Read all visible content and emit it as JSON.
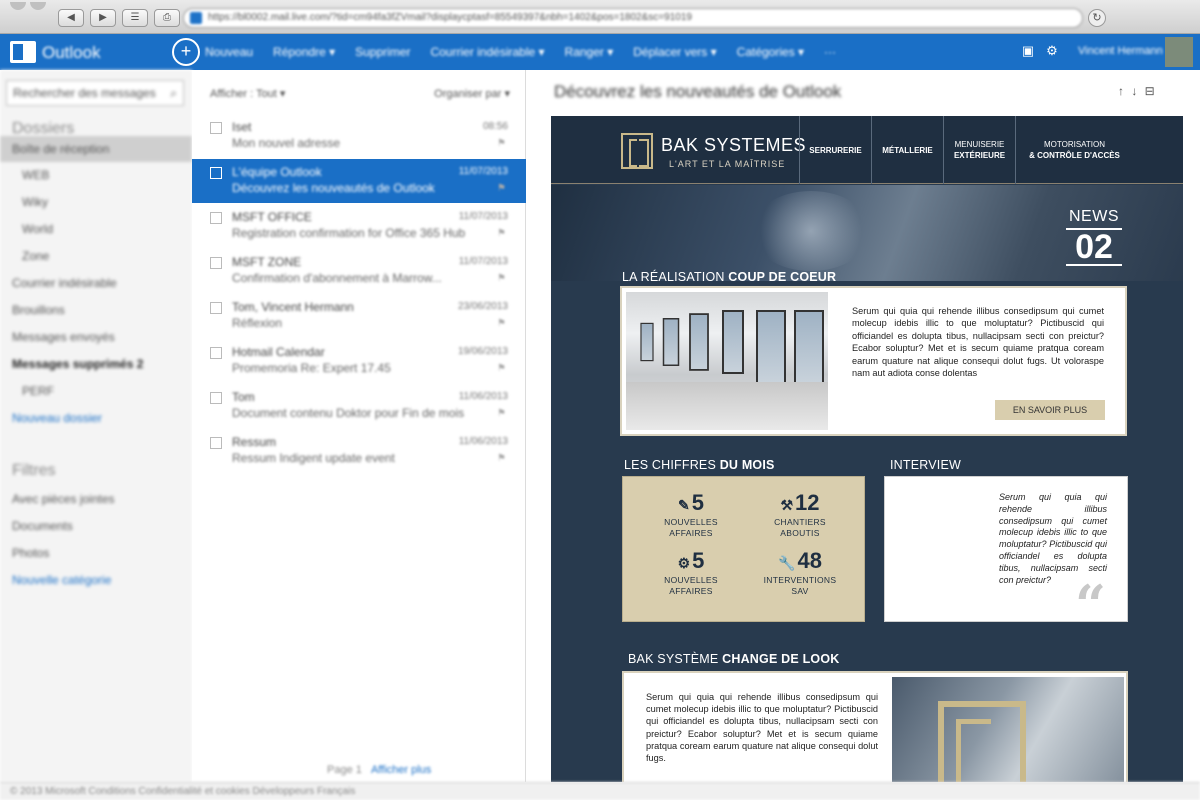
{
  "browser": {
    "url": "https://bl0002.mail.live.com/?tid=cm94fa3fZVmail?displaycptasf=85549397&nbh=1402&pos=1802&sc=91019",
    "back": "◀",
    "forward": "▶",
    "reload": "↻"
  },
  "outlook": {
    "brand": "Outlook",
    "commands": [
      "Nouveau",
      "Répondre ▾",
      "Supprimer",
      "Courrier indésirable ▾",
      "Ranger ▾",
      "Déplacer vers ▾",
      "Catégories ▾",
      "···"
    ],
    "user": "Vincent Hermann"
  },
  "sidebar": {
    "search_placeholder": "Rechercher des messages",
    "folders_title": "Dossiers",
    "folders": [
      {
        "label": "Boîte de réception",
        "type": "selected"
      },
      {
        "label": "WEB",
        "type": "sub"
      },
      {
        "label": "Wiky",
        "type": "sub"
      },
      {
        "label": "World",
        "type": "sub"
      },
      {
        "label": "Zone",
        "type": "sub"
      },
      {
        "label": "Courrier indésirable",
        "type": "normal"
      },
      {
        "label": "Brouillons",
        "type": "normal"
      },
      {
        "label": "Messages envoyés",
        "type": "normal"
      },
      {
        "label": "Messages supprimés 2",
        "type": "bold"
      },
      {
        "label": "PERF",
        "type": "sub"
      },
      {
        "label": "Nouveau dossier",
        "type": "link"
      }
    ],
    "filters_title": "Filtres",
    "filters": [
      {
        "label": "Avec pièces jointes",
        "type": "normal"
      },
      {
        "label": "Documents",
        "type": "normal"
      },
      {
        "label": "Photos",
        "type": "normal"
      },
      {
        "label": "Nouvelle catégorie",
        "type": "link"
      }
    ]
  },
  "list": {
    "filter": "Afficher : Tout ▾",
    "sort": "Organiser par ▾",
    "messages": [
      {
        "from": "Iset",
        "subject": "Mon nouvel adresse",
        "date": "08:56",
        "selected": false
      },
      {
        "from": "L'équipe Outlook",
        "subject": "Découvrez les nouveautés de Outlook",
        "date": "11/07/2013",
        "selected": true
      },
      {
        "from": "MSFT OFFICE",
        "subject": "Registration confirmation for Office 365 Hub",
        "date": "11/07/2013",
        "selected": false
      },
      {
        "from": "MSFT ZONE",
        "subject": "Confirmation d'abonnement à Marrow...",
        "date": "11/07/2013",
        "selected": false
      },
      {
        "from": "Tom, Vincent Hermann",
        "subject": "Réflexion",
        "date": "23/06/2013",
        "selected": false
      },
      {
        "from": "Hotmail Calendar",
        "subject": "Promemoria Re: Expert 17.45",
        "date": "19/06/2013",
        "selected": false
      },
      {
        "from": "Tom",
        "subject": "Document contenu Doktor pour Fin de mois",
        "date": "11/06/2013",
        "selected": false
      },
      {
        "from": "Ressum",
        "subject": "Ressum Indigent update event",
        "date": "11/06/2013",
        "selected": false
      }
    ],
    "pager_label": "Page 1",
    "pager_current": "Afficher plus"
  },
  "reading": {
    "subject": "Découvrez les nouveautés de Outlook",
    "icons": "↑ ↓ ⊟"
  },
  "newsletter": {
    "brand_name": "BAK SYSTEMES",
    "tagline": "L'ART ET LA MAÎTRISE",
    "nav": [
      "SERRURERIE",
      "MÉTALLERIE",
      "MENUISERIE",
      "EXTÉRIEURE",
      "MOTORISATION",
      "& CONTRÔLE D'ACCÈS"
    ],
    "news_label": "NEWS",
    "news_number": "02",
    "sec1_light": "LA RÉALISATION",
    "sec1_bold": "COUP DE COEUR",
    "sec1_text": "Serum qui quia qui rehende illibus consedipsum qui cumet molecup idebis illic to que moluptatur? Pictibuscid qui officiandel es dolupta tibus, nullacipsam secti con preictur? Ecabor soluptur? Met et is secum quiame pratqua coream earum quature nat alique consequi dolut fugs. Ut voloraspe nam aut adiota conse dolentas",
    "more_button": "EN SAVOIR PLUS",
    "sec2_light": "LES CHIFFRES",
    "sec2_bold": "DU MOIS",
    "stats": [
      {
        "icon": "✎",
        "value": "5",
        "label1": "NOUVELLES",
        "label2": "AFFAIRES"
      },
      {
        "icon": "⚒",
        "value": "12",
        "label1": "CHANTIERS",
        "label2": "ABOUTIS"
      },
      {
        "icon": "⚙",
        "value": "5",
        "label1": "NOUVELLES",
        "label2": "AFFAIRES"
      },
      {
        "icon": "🔧",
        "value": "48",
        "label1": "INTERVENTIONS",
        "label2": "SAV"
      }
    ],
    "interview_title": "INTERVIEW",
    "interview_text": "Serum qui quia qui rehende illibus consedipsum qui cumet molecup idebis illic to que moluptatur? Pictibuscid qui officiandel es dolupta tibus, nullacipsam secti con preictur?",
    "sec3_light": "BAK SYSTÈME",
    "sec3_bold": "CHANGE DE LOOK",
    "sec3_text": "Serum qui quia qui rehende illibus consedipsum qui cumet molecup idebis illic to que moluptatur? Pictibuscid qui officiandel es dolupta tibus, nullacipsam secti con preictur? Ecabor soluptur? Met et is secum quiame pratqua coream earum quature nat alique consequi dolut fugs."
  },
  "status": {
    "text": "© 2013 Microsoft     Conditions     Confidentialité et cookies     Développeurs     Français"
  }
}
